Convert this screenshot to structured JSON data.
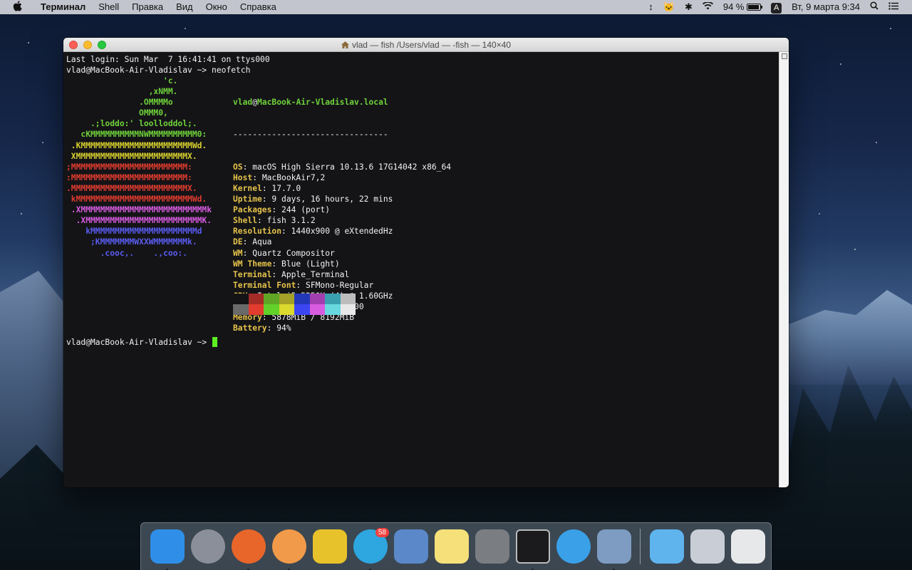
{
  "menubar": {
    "apple_icon": "apple-icon",
    "app_name": "Терминал",
    "menus": [
      "Shell",
      "Правка",
      "Вид",
      "Окно",
      "Справка"
    ],
    "battery_percent": "94 %",
    "battery_level": 0.94,
    "input_source": "A",
    "datetime": "Вт, 9 марта  9:34"
  },
  "window": {
    "title": "vlad — fish /Users/vlad — -fish — 140×40",
    "lines": [
      "Last login: Sun Mar  7 16:41:41 on ttys000",
      "vlad@MacBook-Air-Vladislav ~> neofetch"
    ],
    "logo": [
      {
        "text": "                    'c.",
        "color": "#6fd13a"
      },
      {
        "text": "                 ,xNMM.",
        "color": "#6fd13a"
      },
      {
        "text": "               .OMMMMo",
        "color": "#6fd13a"
      },
      {
        "text": "               OMMM0,",
        "color": "#6fd13a"
      },
      {
        "text": "     .;loddo:' loolloddol;.",
        "color": "#6fd13a"
      },
      {
        "text": "   cKMMMMMMMMMMNWMMMMMMMMMM0:",
        "color": "#6fd13a"
      },
      {
        "text": " .KMMMMMMMMMMMMMMMMMMMMMMMWd.",
        "color": "#d8d02e"
      },
      {
        "text": " XMMMMMMMMMMMMMMMMMMMMMMMX.",
        "color": "#d8d02e"
      },
      {
        "text": ";MMMMMMMMMMMMMMMMMMMMMMMM:",
        "color": "#e23c2f"
      },
      {
        "text": ":MMMMMMMMMMMMMMMMMMMMMMMM:",
        "color": "#e23c2f"
      },
      {
        "text": ".MMMMMMMMMMMMMMMMMMMMMMMMX.",
        "color": "#e23c2f"
      },
      {
        "text": " kMMMMMMMMMMMMMMMMMMMMMMMMWd.",
        "color": "#e23c2f"
      },
      {
        "text": " .XMMMMMMMMMMMMMMMMMMMMMMMMMMk",
        "color": "#d75ce0"
      },
      {
        "text": "  .XMMMMMMMMMMMMMMMMMMMMMMMMK.",
        "color": "#d75ce0"
      },
      {
        "text": "    kMMMMMMMMMMMMMMMMMMMMMMd",
        "color": "#5a5cf0"
      },
      {
        "text": "     ;KMMMMMMMWXXWMMMMMMMk.",
        "color": "#5a5cf0"
      },
      {
        "text": "       .cooc,.    .,coo:.",
        "color": "#5a5cf0"
      }
    ],
    "host_user": "vlad",
    "host_at": "@",
    "host_name": "MacBook-Air-Vladislav.local",
    "separator": "--------------------------------",
    "info": [
      {
        "key": "OS",
        "value": "macOS High Sierra 10.13.6 17G14042 x86_64"
      },
      {
        "key": "Host",
        "value": "MacBookAir7,2"
      },
      {
        "key": "Kernel",
        "value": "17.7.0"
      },
      {
        "key": "Uptime",
        "value": "9 days, 16 hours, 22 mins"
      },
      {
        "key": "Packages",
        "value": "244 (port)"
      },
      {
        "key": "Shell",
        "value": "fish 3.1.2"
      },
      {
        "key": "Resolution",
        "value": "1440x900 @ eXtendedHz"
      },
      {
        "key": "DE",
        "value": "Aqua"
      },
      {
        "key": "WM",
        "value": "Quartz Compositor"
      },
      {
        "key": "WM Theme",
        "value": "Blue (Light)"
      },
      {
        "key": "Terminal",
        "value": "Apple_Terminal"
      },
      {
        "key": "Terminal Font",
        "value": "SFMono-Regular"
      },
      {
        "key": "CPU",
        "value": "Intel i5-5250U (4) @ 1.60GHz"
      },
      {
        "key": "GPU",
        "value": "Intel HD Graphics 6000"
      },
      {
        "key": "Memory",
        "value": "5878MiB / 8192MiB"
      },
      {
        "key": "Battery",
        "value": "94%"
      }
    ],
    "palette_dark": [
      "#141417",
      "#a32c26",
      "#5fa625",
      "#a4a028",
      "#2338b8",
      "#a23fb0",
      "#3aa0b0",
      "#bdbdbd"
    ],
    "palette_bright": [
      "#6a6a6a",
      "#e23c2f",
      "#62d12a",
      "#dbd82e",
      "#3b46f2",
      "#d75ce0",
      "#67d9df",
      "#e8e8e8"
    ],
    "prompt": "vlad@MacBook-Air-Vladislav ~> "
  },
  "dock": {
    "items": [
      {
        "name": "finder",
        "icon": "finder-icon",
        "color": "#2f8fe8",
        "running": true
      },
      {
        "name": "launchpad",
        "icon": "launchpad-icon",
        "color": "#8a8f99",
        "running": false
      },
      {
        "name": "firefox",
        "icon": "firefox-icon",
        "color": "#e8662a",
        "running": true
      },
      {
        "name": "mandarin",
        "icon": "mandarin-icon",
        "color": "#f19a4a",
        "running": true
      },
      {
        "name": "zx-tune",
        "icon": "zx-tune-icon",
        "color": "#e8c22a",
        "running": false
      },
      {
        "name": "telegram",
        "icon": "telegram-icon",
        "color": "#2ea6e0",
        "running": true,
        "badge": "58"
      },
      {
        "name": "preview-mail",
        "icon": "stamp-icon",
        "color": "#5a88c8",
        "running": false
      },
      {
        "name": "notes",
        "icon": "notes-icon",
        "color": "#f6e07a",
        "running": false
      },
      {
        "name": "system-preferences",
        "icon": "gear-icon",
        "color": "#7a7d82",
        "running": false
      },
      {
        "name": "terminal",
        "icon": "terminal-icon",
        "color": "#1b1b1d",
        "running": true
      },
      {
        "name": "app-store-bird",
        "icon": "bird-icon",
        "color": "#3aa0e8",
        "running": false
      },
      {
        "name": "image-capture",
        "icon": "photos-icon",
        "color": "#7e9cc2",
        "running": true
      }
    ],
    "right": [
      {
        "name": "applications",
        "icon": "applications-folder-icon",
        "color": "#5fb4ee"
      },
      {
        "name": "downloads",
        "icon": "downloads-stack-icon",
        "color": "#c9ced6"
      },
      {
        "name": "trash",
        "icon": "trash-icon",
        "color": "#e6e8ea"
      }
    ]
  }
}
